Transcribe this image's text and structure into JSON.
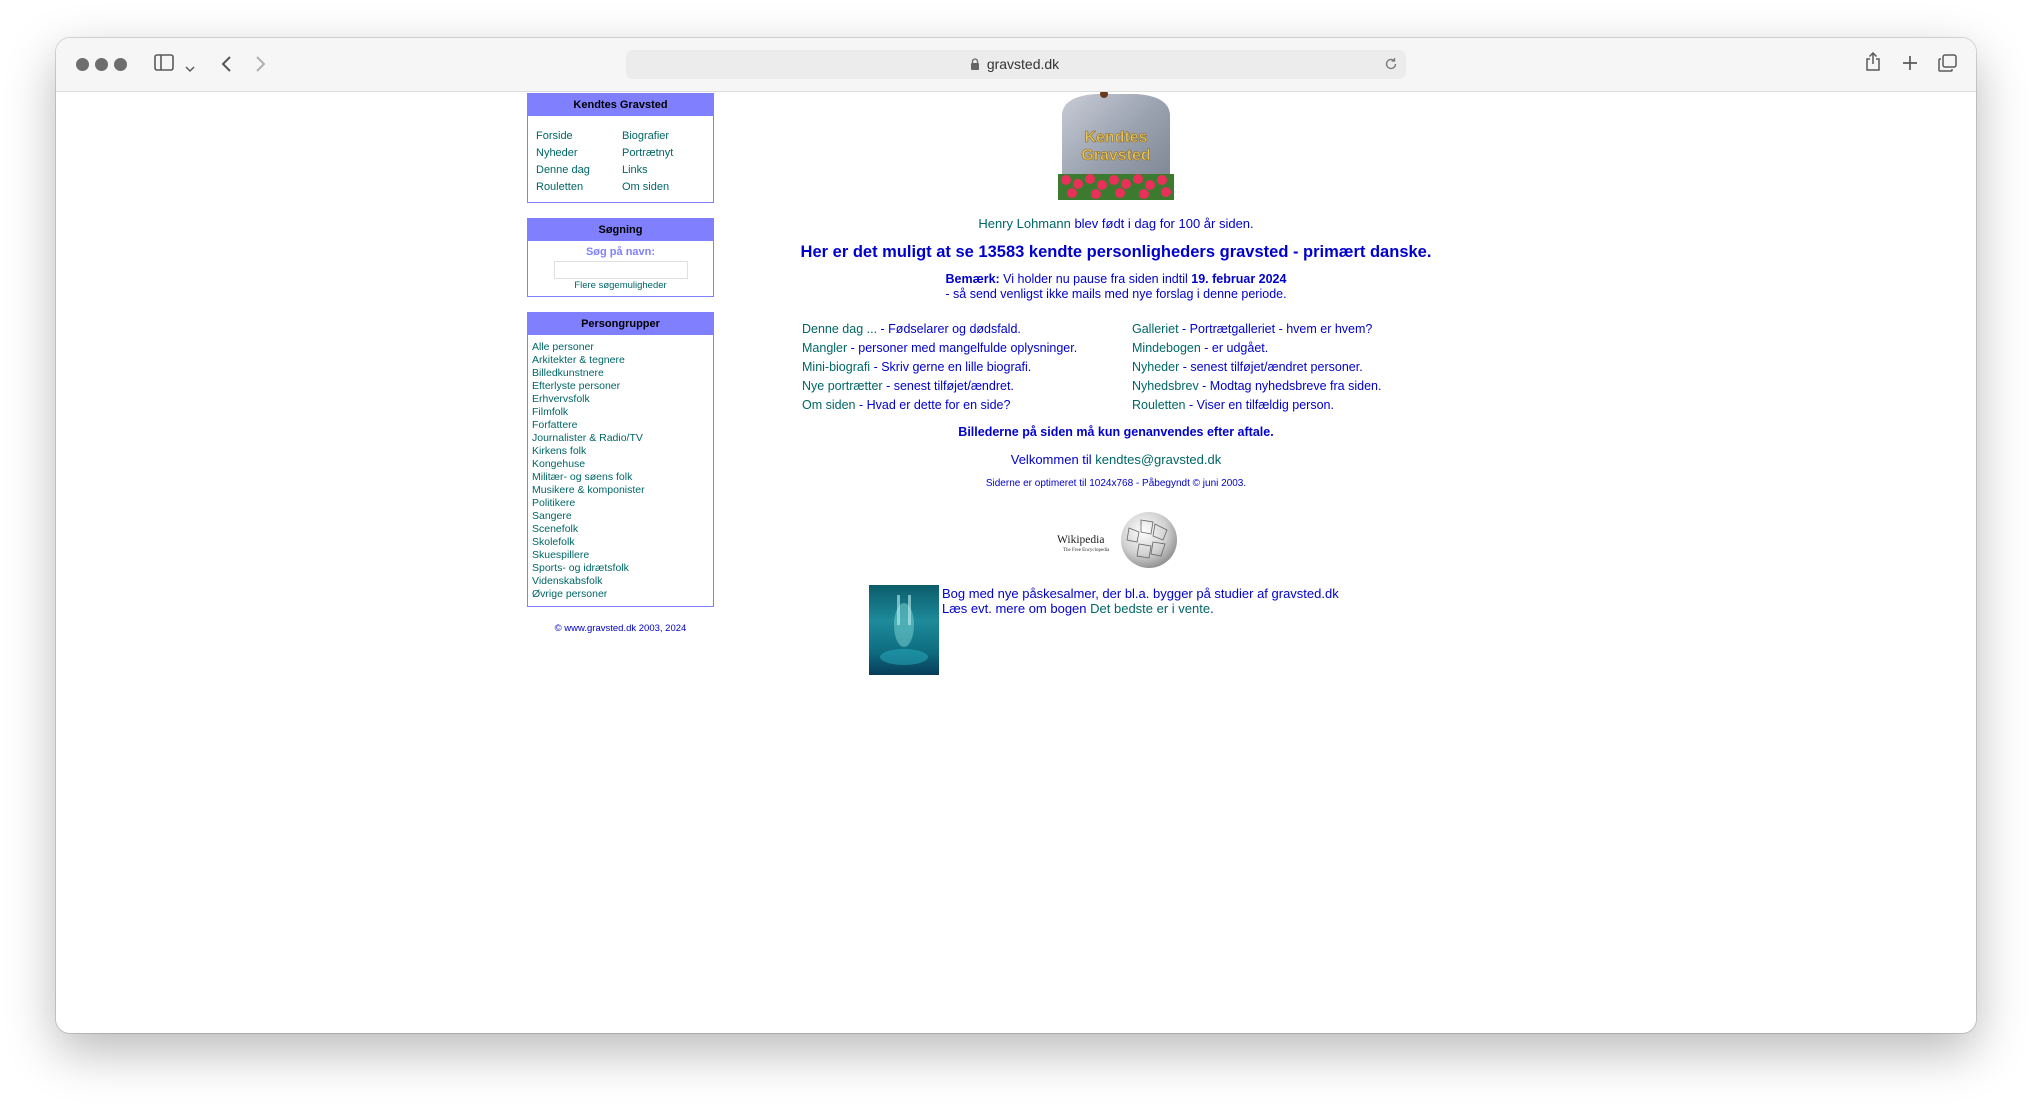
{
  "browser": {
    "url": "gravsted.dk"
  },
  "nav_box": {
    "title": "Kendtes Gravsted",
    "links": [
      "Forside",
      "Biografier",
      "Nyheder",
      "Portrætnyt",
      "Denne dag",
      "Links",
      "Rouletten",
      "Om siden"
    ]
  },
  "search_box": {
    "title": "Søgning",
    "label": "Søg på navn:",
    "input_value": "",
    "more_link": "Flere søgemuligheder"
  },
  "groups_box": {
    "title": "Persongrupper",
    "items": [
      "Alle personer",
      "Arkitekter & tegnere",
      "Billedkunstnere",
      "Efterlyste personer",
      "Erhvervsfolk",
      "Filmfolk",
      "Forfattere",
      "Journalister & Radio/TV",
      "Kirkens folk",
      "Kongehuse",
      "Militær- og søens folk",
      "Musikere & komponister",
      "Politikere",
      "Sangere",
      "Scenefolk",
      "Skolefolk",
      "Skuespillere",
      "Sports- og idrætsfolk",
      "Videnskabsfolk",
      "Øvrige personer"
    ]
  },
  "copyright": "© www.gravsted.dk 2003, 2024",
  "logo": {
    "line1": "Kendtes",
    "line2": "Gravsted"
  },
  "main": {
    "birthday_name": "Henry Lohmann",
    "birthday_text": " blev født i dag for 100 år siden.",
    "headline": "Her er det muligt at se 13583 kendte personligheders gravsted - primært danske.",
    "notice_label": "Bemærk:",
    "notice_text": " Vi holder nu pause fra siden indtil ",
    "notice_date": "19. februar 2024",
    "notice_line2": "- så send venligst ikke mails med nye forslag i denne periode.",
    "links_left": [
      {
        "link": "Denne dag ...",
        "desc": " - Fødselarer og dødsfald."
      },
      {
        "link": "Mangler",
        "desc": " - personer med mangelfulde oplysninger."
      },
      {
        "link": "Mini-biografi",
        "desc": " - Skriv gerne en lille biografi."
      },
      {
        "link": "Nye portrætter",
        "desc": " - senest tilføjet/ændret."
      },
      {
        "link": "Om siden",
        "desc": " - Hvad er dette for en side?"
      }
    ],
    "links_right": [
      {
        "link": "Galleriet",
        "desc": " - Portrætgalleriet - hvem er hvem?"
      },
      {
        "link": "Mindebogen",
        "desc": " - er udgået."
      },
      {
        "link": "Nyheder",
        "desc": " - senest tilføjet/ændret personer."
      },
      {
        "link": "Nyhedsbrev",
        "desc": " - Modtag nyhedsbreve fra siden."
      },
      {
        "link": "Rouletten",
        "desc": " - Viser en tilfældig person."
      }
    ],
    "images_notice": "Billederne på siden må kun genanvendes efter aftale.",
    "welcome_text": "Velkommen til ",
    "welcome_email": "kendtes@gravsted.dk",
    "optimized": "Siderne er optimeret til 1024x768 - Påbegyndt © juni 2003.",
    "wikipedia_title": "Wikipedia",
    "wikipedia_sub": "The Free Encyclopedia",
    "book_line1": "Bog med nye påskesalmer, der bl.a. bygger på studier af gravsted.dk",
    "book_line2_prefix": "Læs evt. mere om bogen ",
    "book_link": "Det bedste er i vente",
    "book_line2_suffix": "."
  }
}
